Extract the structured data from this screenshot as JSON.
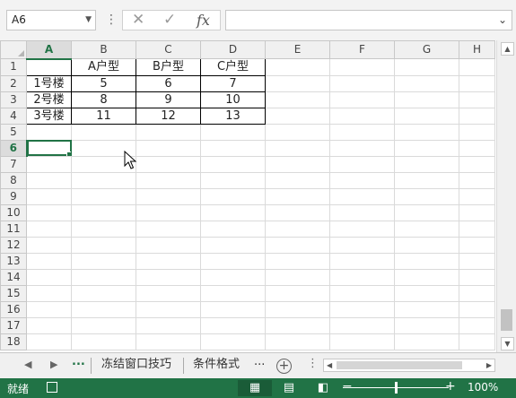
{
  "formula_bar": {
    "name_box": "A6",
    "cancel_symbol": "✕",
    "enter_symbol": "✓",
    "fx_label": "fx",
    "formula_value": ""
  },
  "columns": [
    "A",
    "B",
    "C",
    "D",
    "E",
    "F",
    "G",
    "H"
  ],
  "rows": [
    "1",
    "2",
    "3",
    "4",
    "5",
    "6",
    "7",
    "8",
    "9",
    "10",
    "11",
    "12",
    "13",
    "14",
    "15",
    "16",
    "17",
    "18"
  ],
  "cells": [
    [
      "",
      "A户型",
      "B户型",
      "C户型"
    ],
    [
      "1号楼",
      "5",
      "6",
      "7"
    ],
    [
      "2号楼",
      "8",
      "9",
      "10"
    ],
    [
      "3号楼",
      "11",
      "12",
      "13"
    ]
  ],
  "active_cell": "A6",
  "sheet_tabs": {
    "more_left": "...",
    "tabs": [
      "冻结窗口技巧",
      "条件格式"
    ],
    "more_right": "...",
    "add_label": "+"
  },
  "status": {
    "ready": "就绪",
    "zoom": "100%"
  }
}
